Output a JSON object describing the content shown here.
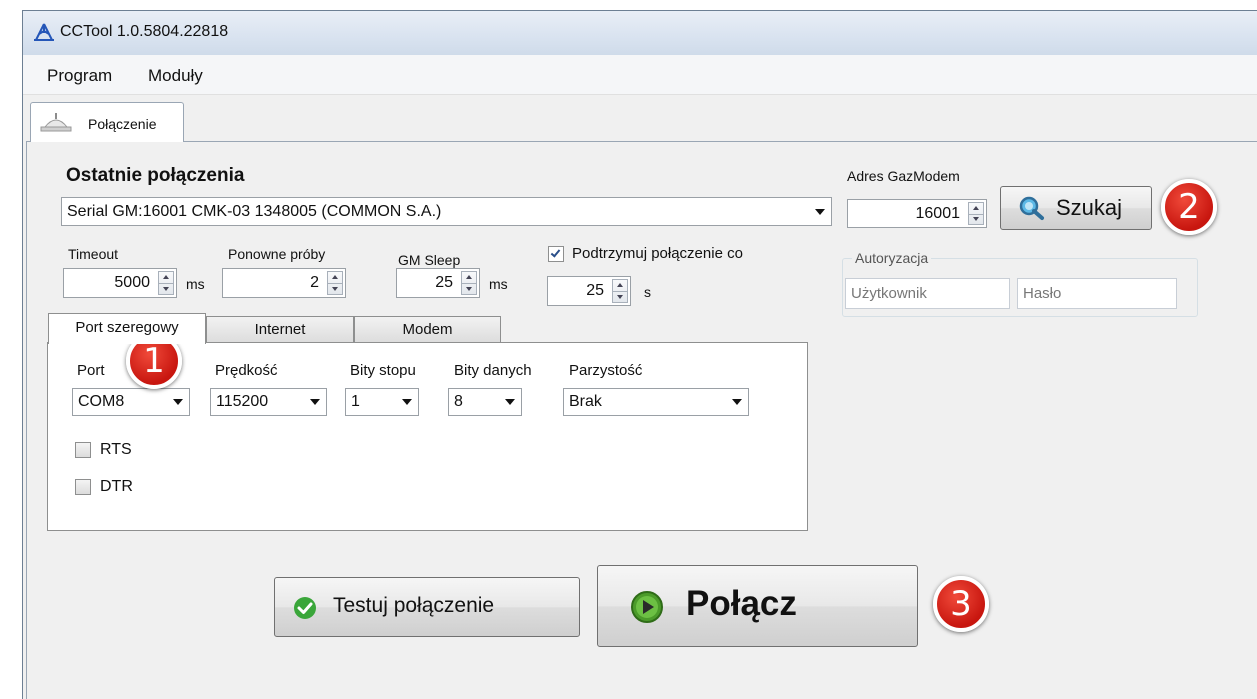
{
  "window": {
    "title": "CCTool 1.0.5804.22818"
  },
  "menu": [
    "Program",
    "Moduły"
  ],
  "main_tab": {
    "label": "Połączenie"
  },
  "recent": {
    "label": "Ostatnie połączenia",
    "value": "Serial GM:16001 CMK-03 1348005 (COMMON S.A.)"
  },
  "address": {
    "label": "Adres GazModem",
    "value": "16001"
  },
  "search_button": "Szukaj",
  "auth": {
    "label": "Autoryzacja",
    "user_placeholder": "Użytkownik",
    "password_placeholder": "Hasło"
  },
  "timeout": {
    "label": "Timeout",
    "value": "5000",
    "unit": "ms"
  },
  "retries": {
    "label": "Ponowne próby",
    "value": "2"
  },
  "gm_sleep": {
    "label": "GM Sleep",
    "value": "25",
    "unit": "ms"
  },
  "keepalive": {
    "label": "Podtrzymuj połączenie co",
    "checked": true,
    "value": "25",
    "unit": "s"
  },
  "subtabs": [
    "Port szeregowy",
    "Internet",
    "Modem"
  ],
  "serial": {
    "port": {
      "label": "Port",
      "value": "COM8"
    },
    "speed": {
      "label": "Prędkość",
      "value": "115200"
    },
    "stop_bits": {
      "label": "Bity stopu",
      "value": "1"
    },
    "data_bits": {
      "label": "Bity danych",
      "value": "8"
    },
    "parity": {
      "label": "Parzystość",
      "value": "Brak"
    },
    "rts": {
      "label": "RTS",
      "checked": false
    },
    "dtr": {
      "label": "DTR",
      "checked": false
    }
  },
  "test_button": "Testuj połączenie",
  "connect_button": "Połącz",
  "callouts": [
    "1",
    "2",
    "3"
  ],
  "colors": {
    "badge": "#d9251b",
    "ok_green": "#3aa63a",
    "play_green": "#4b9b2a"
  }
}
